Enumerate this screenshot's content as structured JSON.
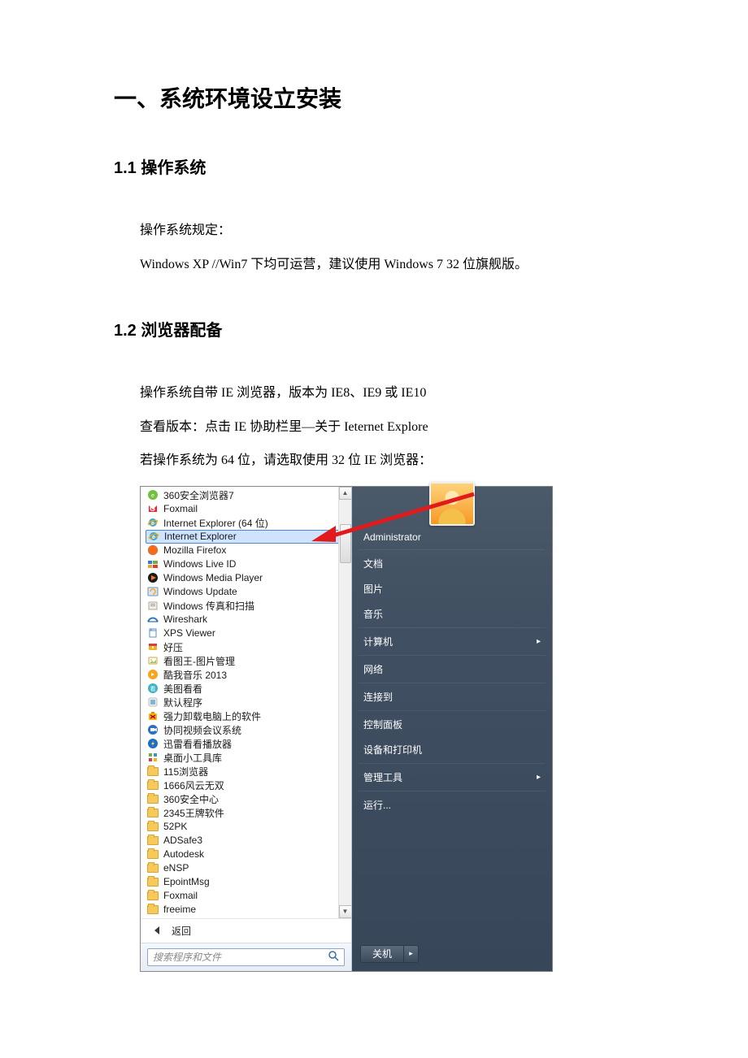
{
  "doc": {
    "h1": "一、系统环境设立安装",
    "s1_h": "1.1  操作系统",
    "s1_p1": "操作系统规定：",
    "s1_p2": "Windows    XP //Win7  下均可运营，建议使用 Windows 7 32 位旗舰版。",
    "s2_h": "1.2  浏览器配备",
    "s2_p1": "操作系统自带 IE 浏览器，版本为 IE8、IE9 或 IE10",
    "s2_p2": "查看版本：点击 IE 协助栏里—关于 Ieternet Explore",
    "s2_p3": "若操作系统为 64 位，请选取使用 32 位 IE 浏览器："
  },
  "startmenu": {
    "programs": [
      {
        "label": "360安全浏览器7",
        "icon": "360-green"
      },
      {
        "label": "Foxmail",
        "icon": "foxmail"
      },
      {
        "label": "Internet Explorer (64 位)",
        "icon": "ie"
      },
      {
        "label": "Internet Explorer",
        "icon": "ie",
        "highlighted": true
      },
      {
        "label": "Mozilla Firefox",
        "icon": "firefox"
      },
      {
        "label": "Windows Live ID",
        "icon": "liveid"
      },
      {
        "label": "Windows Media Player",
        "icon": "wmp"
      },
      {
        "label": "Windows Update",
        "icon": "winupdate"
      },
      {
        "label": "Windows 传真和扫描",
        "icon": "fax"
      },
      {
        "label": "Wireshark",
        "icon": "wireshark"
      },
      {
        "label": "XPS Viewer",
        "icon": "xps"
      },
      {
        "label": "好压",
        "icon": "haozip"
      },
      {
        "label": "看图王-图片管理",
        "icon": "kantu"
      },
      {
        "label": "酷我音乐 2013",
        "icon": "kuwo"
      },
      {
        "label": "美图看看",
        "icon": "meitu"
      },
      {
        "label": "默认程序",
        "icon": "default"
      },
      {
        "label": "强力卸载电脑上的软件",
        "icon": "uninstall"
      },
      {
        "label": "协同视频会议系统",
        "icon": "video"
      },
      {
        "label": "迅雷看看播放器",
        "icon": "xunlei"
      },
      {
        "label": "桌面小工具库",
        "icon": "gadgets"
      },
      {
        "label": "115浏览器",
        "icon": "folder"
      },
      {
        "label": "1666风云无双",
        "icon": "folder"
      },
      {
        "label": "360安全中心",
        "icon": "folder"
      },
      {
        "label": "2345王牌软件",
        "icon": "folder"
      },
      {
        "label": "52PK",
        "icon": "folder"
      },
      {
        "label": "ADSafe3",
        "icon": "folder"
      },
      {
        "label": "Autodesk",
        "icon": "folder"
      },
      {
        "label": "eNSP",
        "icon": "folder"
      },
      {
        "label": "EpointMsg",
        "icon": "folder"
      },
      {
        "label": "Foxmail",
        "icon": "folder"
      },
      {
        "label": "freeime",
        "icon": "folder"
      }
    ],
    "back_label": "返回",
    "search_placeholder": "搜索程序和文件",
    "right": {
      "user": "Administrator",
      "items": [
        {
          "label": "文档"
        },
        {
          "label": "图片"
        },
        {
          "label": "音乐"
        },
        {
          "sep": true
        },
        {
          "label": "计算机",
          "arrow": true
        },
        {
          "sep": true
        },
        {
          "label": "网络"
        },
        {
          "sep": true
        },
        {
          "label": "连接到"
        },
        {
          "sep": true
        },
        {
          "label": "控制面板"
        },
        {
          "label": "设备和打印机"
        },
        {
          "sep": true
        },
        {
          "label": "管理工具",
          "arrow": true
        },
        {
          "sep": true
        },
        {
          "label": "运行..."
        }
      ],
      "shutdown": "关机"
    }
  },
  "colors": {
    "arrow": "#e11b1b"
  }
}
